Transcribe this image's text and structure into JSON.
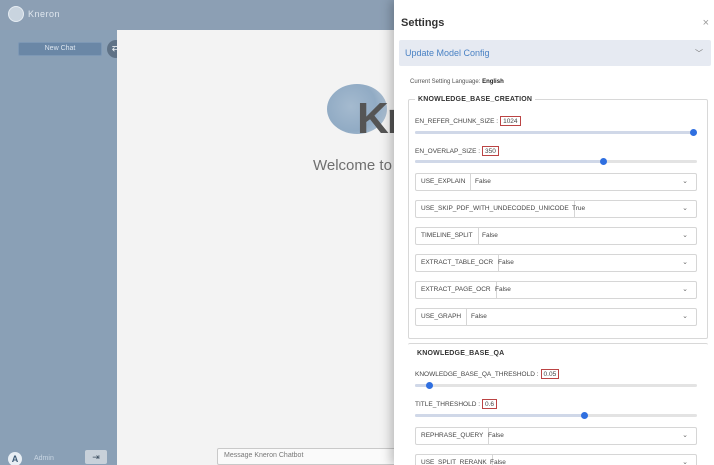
{
  "app": {
    "brand": "Kneron",
    "new_chat_label": "New Chat",
    "user_initial": "A",
    "user_name": "Admin",
    "welcome_text": "Welcome to",
    "big_logo_text": "Kne",
    "message_placeholder": "Message Kneron Chatbot"
  },
  "settings": {
    "title": "Settings",
    "close": "×",
    "model_config_label": "Update Model Config",
    "language_prefix": "Current Setting Language: ",
    "language_value": "English",
    "kb_creation": {
      "title": "KNOWLEDGE_BASE_CREATION",
      "chunk_label": "EN_REFER_CHUNK_SIZE :",
      "chunk_value": "1024",
      "chunk_level": 1.0,
      "overlap_label": "EN_OVERLAP_SIZE :",
      "overlap_value": "350",
      "overlap_level": 0.67,
      "selects": [
        {
          "label": "USE_EXPLAIN",
          "value": "False"
        },
        {
          "label": "USE_SKIP_PDF_WITH_UNDECODED_UNICODE",
          "value": "True"
        },
        {
          "label": "TIMELINE_SPLIT",
          "value": "False"
        },
        {
          "label": "EXTRACT_TABLE_OCR",
          "value": "False"
        },
        {
          "label": "EXTRACT_PAGE_OCR",
          "value": "False"
        },
        {
          "label": "USE_GRAPH",
          "value": "False"
        }
      ]
    },
    "kb_qa": {
      "title": "KNOWLEDGE_BASE_QA",
      "threshold_label": "KNOWLEDGE_BASE_QA_THRESHOLD :",
      "threshold_value": "0.05",
      "threshold_level": 0.05,
      "title_threshold_label": "TITLE_THRESHOLD :",
      "title_threshold_value": "0.6",
      "title_threshold_level": 0.6,
      "selects": [
        {
          "label": "REPHRASE_QUERY",
          "value": "False"
        },
        {
          "label": "USE_SPLIT_RERANK",
          "value": "False"
        }
      ]
    }
  },
  "colors": {
    "accent": "#2f6fe0",
    "sidebar": "#8aa0b6",
    "topbar": "#8c9fb4"
  }
}
